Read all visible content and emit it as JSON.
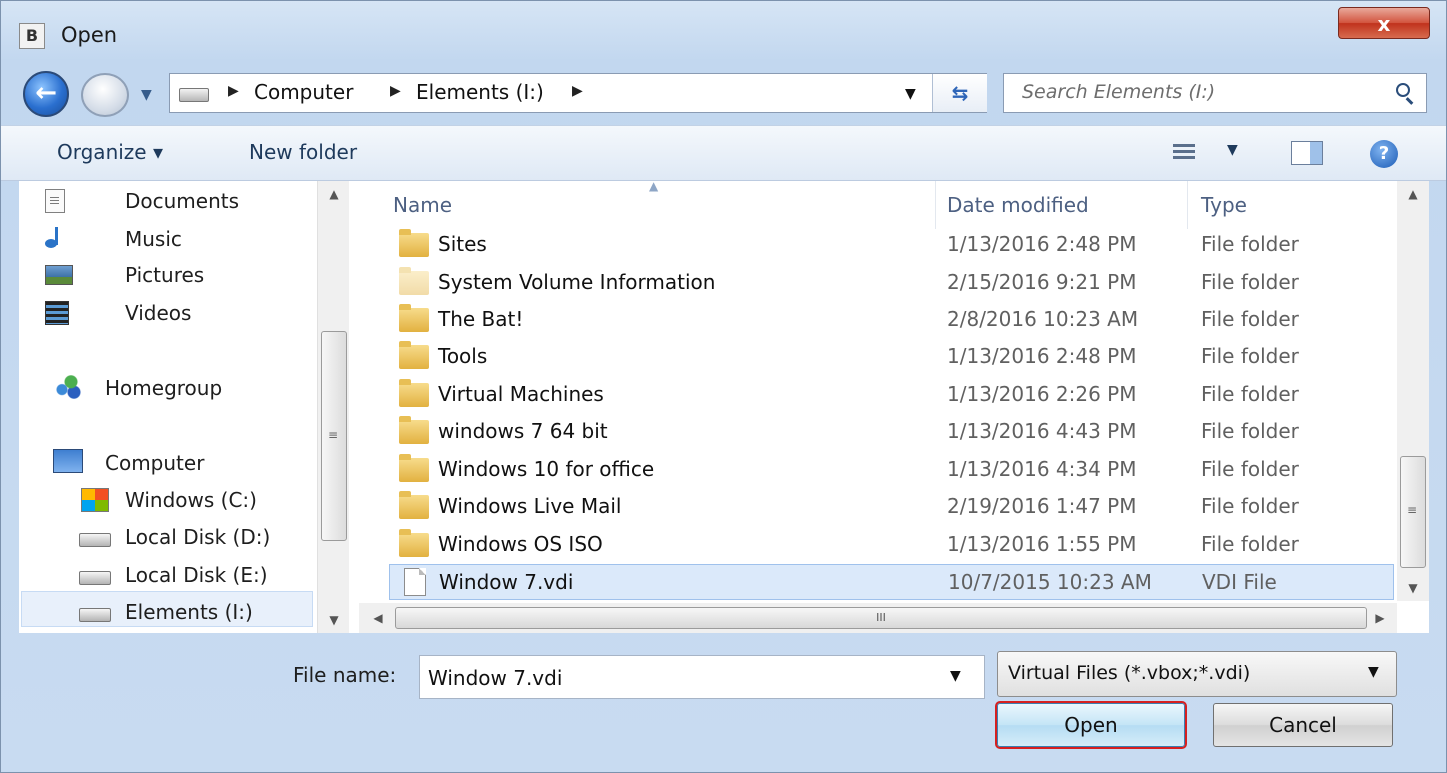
{
  "window": {
    "title": "Open",
    "app_icon_letter": "B",
    "close_label": "x"
  },
  "nav": {
    "breadcrumbs": [
      "Computer",
      "Elements (I:)"
    ],
    "search_placeholder": "Search Elements (I:)"
  },
  "toolbar": {
    "organize_label": "Organize ▾",
    "new_folder_label": "New folder"
  },
  "navpane": {
    "items": [
      {
        "label": "Documents",
        "icon": "documents-icon"
      },
      {
        "label": "Music",
        "icon": "music-icon"
      },
      {
        "label": "Pictures",
        "icon": "pictures-icon"
      },
      {
        "label": "Videos",
        "icon": "videos-icon"
      },
      {
        "label": "Homegroup",
        "icon": "homegroup-icon"
      },
      {
        "label": "Computer",
        "icon": "computer-icon"
      },
      {
        "label": "Windows (C:)",
        "icon": "windows-drive-icon"
      },
      {
        "label": "Local Disk (D:)",
        "icon": "drive-icon"
      },
      {
        "label": "Local Disk (E:)",
        "icon": "drive-icon"
      },
      {
        "label": "Elements (I:)",
        "icon": "drive-icon",
        "selected": true
      }
    ]
  },
  "files": {
    "columns": {
      "name": "Name",
      "date": "Date modified",
      "type": "Type"
    },
    "rows": [
      {
        "name": "Sites",
        "date": "1/13/2016 2:48 PM",
        "type": "File folder"
      },
      {
        "name": "System Volume Information",
        "date": "2/15/2016 9:21 PM",
        "type": "File folder"
      },
      {
        "name": "The Bat!",
        "date": "2/8/2016 10:23 AM",
        "type": "File folder"
      },
      {
        "name": "Tools",
        "date": "1/13/2016 2:48 PM",
        "type": "File folder"
      },
      {
        "name": "Virtual Machines",
        "date": "1/13/2016 2:26 PM",
        "type": "File folder"
      },
      {
        "name": "windows 7 64 bit",
        "date": "1/13/2016 4:43 PM",
        "type": "File folder"
      },
      {
        "name": "Windows 10 for office",
        "date": "1/13/2016 4:34 PM",
        "type": "File folder"
      },
      {
        "name": "Windows Live Mail",
        "date": "2/19/2016 1:47 PM",
        "type": "File folder"
      },
      {
        "name": "Windows OS ISO",
        "date": "1/13/2016 1:55 PM",
        "type": "File folder"
      },
      {
        "name": "Window 7.vdi",
        "date": "10/7/2015 10:23 AM",
        "type": "VDI File",
        "selected": true
      }
    ]
  },
  "bottom": {
    "file_name_label": "File name:",
    "file_name_value": "Window 7.vdi",
    "filter_value": "Virtual Files (*.vbox;*.vdi)",
    "open_label": "Open",
    "cancel_label": "Cancel"
  }
}
